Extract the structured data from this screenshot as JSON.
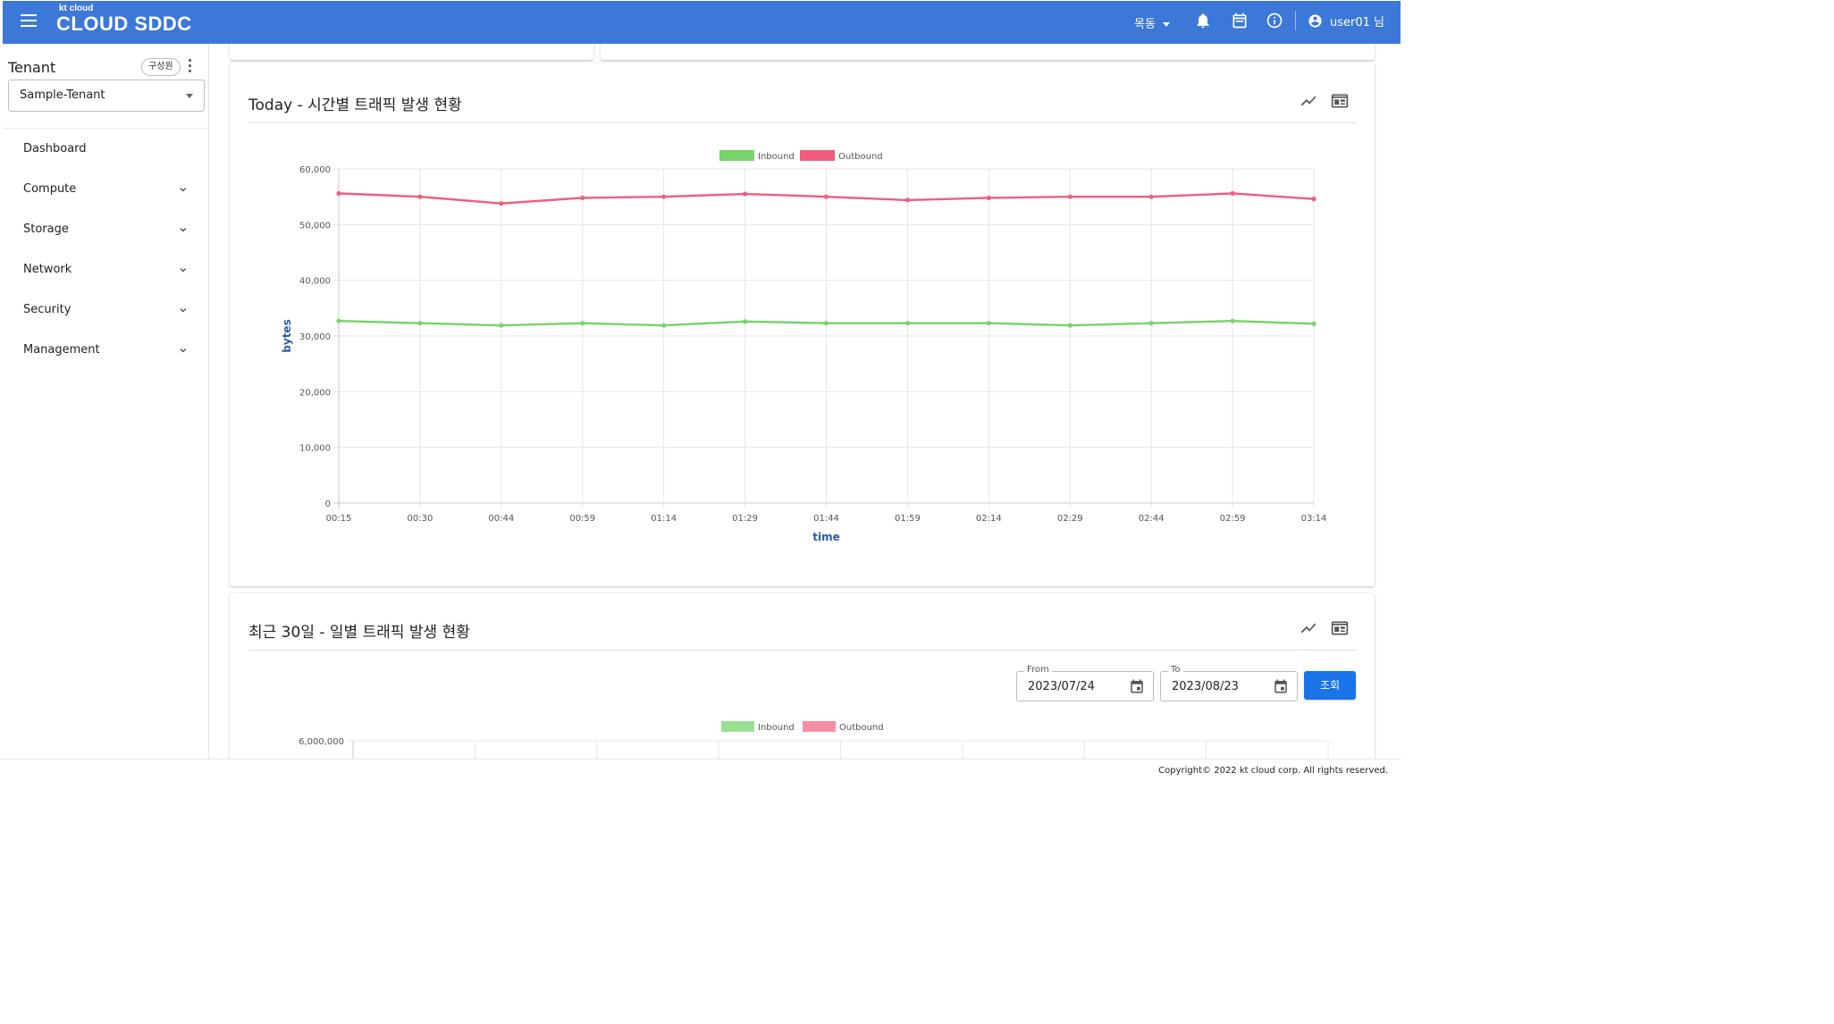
{
  "header": {
    "logo_small": "kt cloud",
    "logo_main": "CLOUD SDDC",
    "region": "목동",
    "user": "user01 님"
  },
  "sidebar": {
    "tenant_title": "Tenant",
    "member_chip": "구성원",
    "tenant_selected": "Sample-Tenant",
    "items": [
      {
        "label": "Dashboard",
        "expandable": false
      },
      {
        "label": "Compute",
        "expandable": true
      },
      {
        "label": "Storage",
        "expandable": true
      },
      {
        "label": "Network",
        "expandable": true
      },
      {
        "label": "Security",
        "expandable": true
      },
      {
        "label": "Management",
        "expandable": true
      }
    ]
  },
  "today_card": {
    "title": "Today - 시간별 트래픽 발생 현황"
  },
  "daily_card": {
    "title": "최근 30일 - 일별 트래픽 발생 현황",
    "from_label": "From",
    "from_value": "2023/07/24",
    "to_label": "To",
    "to_value": "2023/08/23",
    "query_button": "조회"
  },
  "footer": {
    "copyright": "Copyright© 2022 kt cloud corp. All rights reserved."
  },
  "chart_data": [
    {
      "type": "line",
      "xlabel": "time",
      "ylabel": "bytes",
      "x": [
        "00:15",
        "00:30",
        "00:44",
        "00:59",
        "01:14",
        "01:29",
        "01:44",
        "01:59",
        "02:14",
        "02:29",
        "02:44",
        "02:59",
        "03:14"
      ],
      "ylim": [
        0,
        60000
      ],
      "yticks": [
        0,
        10000,
        20000,
        30000,
        40000,
        50000,
        60000
      ],
      "ytick_labels": [
        "0",
        "10,000",
        "20,000",
        "30,000",
        "40,000",
        "50,000",
        "60,000"
      ],
      "grid": true,
      "legend_position": "top-center",
      "series": [
        {
          "name": "Inbound",
          "color": "#77d36b",
          "values": [
            32700,
            32300,
            31900,
            32300,
            31900,
            32600,
            32300,
            32300,
            32300,
            31900,
            32300,
            32700,
            32200
          ]
        },
        {
          "name": "Outbound",
          "color": "#f05d7e",
          "values": [
            55600,
            55000,
            53800,
            54800,
            55000,
            55500,
            55000,
            54400,
            54800,
            55000,
            55000,
            55600,
            54600
          ]
        }
      ]
    },
    {
      "type": "bar",
      "ytick_labels": [
        "6,000,000"
      ],
      "grid": true,
      "legend_position": "top-center",
      "series": [
        {
          "name": "Inbound",
          "color": "#9ae094"
        },
        {
          "name": "Outbound",
          "color": "#f88fa4"
        }
      ]
    }
  ]
}
